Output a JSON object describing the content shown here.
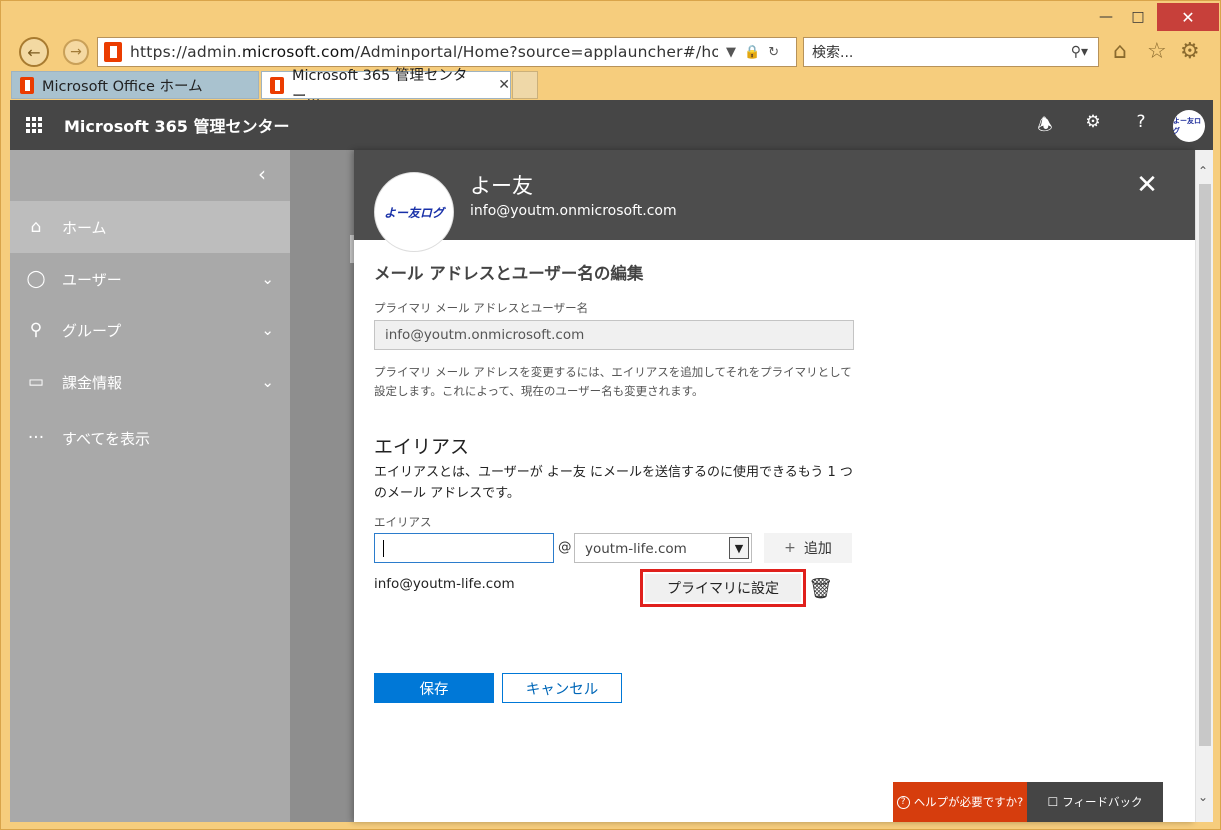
{
  "browser": {
    "url_prefix": "https://admin.",
    "url_domain": "microsoft.com",
    "url_rest": "/Adminportal/Home?source=applauncher#/homep",
    "search_label": "検索...",
    "tabs": [
      {
        "label": "Microsoft Office ホーム"
      },
      {
        "label": "Microsoft 365 管理センター..."
      }
    ]
  },
  "header": {
    "title": "Microsoft 365 管理センター",
    "avatar_text": "よー友ログ"
  },
  "sidebar": {
    "items": [
      {
        "label": "ホーム",
        "icon": "home-icon"
      },
      {
        "label": "ユーザー",
        "icon": "user-icon"
      },
      {
        "label": "グループ",
        "icon": "group-icon"
      },
      {
        "label": "課金情報",
        "icon": "card-icon"
      },
      {
        "label": "すべてを表示",
        "icon": "ellipsis-icon"
      }
    ]
  },
  "panel": {
    "user_name": "よー友",
    "user_email": "info@youtm.onmicrosoft.com",
    "avatar_text": "よー友ログ",
    "section_title": "メール アドレスとユーザー名の編集",
    "primary_label": "プライマリ メール アドレスとユーザー名",
    "primary_value": "info@youtm.onmicrosoft.com",
    "primary_note": "プライマリ メール アドレスを変更するには、エイリアスを追加してそれをプライマリとして設定します。これによって、現在のユーザー名も変更されます。",
    "alias_title": "エイリアス",
    "alias_desc": "エイリアスとは、ユーザーが よー友 にメールを送信するのに使用できるもう 1 つのメール アドレスです。",
    "alias_field_label": "エイリアス",
    "at_sign": "@",
    "domain_value": "youtm-life.com",
    "add_label": "追加",
    "alias_item": "info@youtm-life.com",
    "set_primary_label": "プライマリに設定",
    "save_label": "保存",
    "cancel_label": "キャンセル"
  },
  "footer": {
    "help_label": "ヘルプが必要ですか?",
    "feedback_label": "フィードバック"
  },
  "colors": {
    "accent": "#0078d7",
    "header_bg": "#464646",
    "highlight_border": "#e0201c",
    "help_bg": "#d63d0d"
  }
}
